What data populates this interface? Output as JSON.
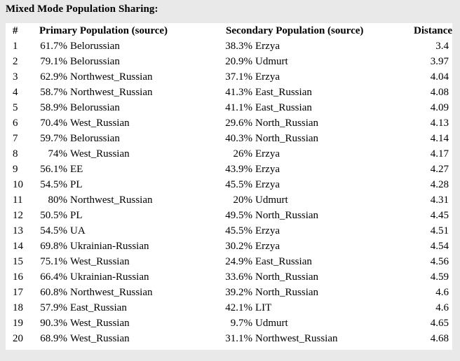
{
  "page": {
    "title": "Mixed Mode Population Sharing:",
    "background_color": "#e9e9e9",
    "panel_color": "#ffffff",
    "text_color": "#000000"
  },
  "table": {
    "headers": {
      "rank": "#",
      "primary": "Primary Population (source)",
      "secondary": "Secondary Population (source)",
      "distance": "Distance"
    },
    "rows": [
      {
        "rank": "1",
        "primary_pct": "61.7%",
        "primary_name": "Belorussian",
        "secondary_pct": "38.3%",
        "secondary_name": "Erzya",
        "distance": "3.4"
      },
      {
        "rank": "2",
        "primary_pct": "79.1%",
        "primary_name": "Belorussian",
        "secondary_pct": "20.9%",
        "secondary_name": "Udmurt",
        "distance": "3.97"
      },
      {
        "rank": "3",
        "primary_pct": "62.9%",
        "primary_name": "Northwest_Russian",
        "secondary_pct": "37.1%",
        "secondary_name": "Erzya",
        "distance": "4.04"
      },
      {
        "rank": "4",
        "primary_pct": "58.7%",
        "primary_name": "Northwest_Russian",
        "secondary_pct": "41.3%",
        "secondary_name": "East_Russian",
        "distance": "4.08"
      },
      {
        "rank": "5",
        "primary_pct": "58.9%",
        "primary_name": "Belorussian",
        "secondary_pct": "41.1%",
        "secondary_name": "East_Russian",
        "distance": "4.09"
      },
      {
        "rank": "6",
        "primary_pct": "70.4%",
        "primary_name": "West_Russian",
        "secondary_pct": "29.6%",
        "secondary_name": "North_Russian",
        "distance": "4.13"
      },
      {
        "rank": "7",
        "primary_pct": "59.7%",
        "primary_name": "Belorussian",
        "secondary_pct": "40.3%",
        "secondary_name": "North_Russian",
        "distance": "4.14"
      },
      {
        "rank": "8",
        "primary_pct": "74%",
        "primary_name": "West_Russian",
        "secondary_pct": "26%",
        "secondary_name": "Erzya",
        "distance": "4.17"
      },
      {
        "rank": "9",
        "primary_pct": "56.1%",
        "primary_name": "EE",
        "secondary_pct": "43.9%",
        "secondary_name": "Erzya",
        "distance": "4.27"
      },
      {
        "rank": "10",
        "primary_pct": "54.5%",
        "primary_name": "PL",
        "secondary_pct": "45.5%",
        "secondary_name": "Erzya",
        "distance": "4.28"
      },
      {
        "rank": "11",
        "primary_pct": "80%",
        "primary_name": "Northwest_Russian",
        "secondary_pct": "20%",
        "secondary_name": "Udmurt",
        "distance": "4.31"
      },
      {
        "rank": "12",
        "primary_pct": "50.5%",
        "primary_name": "PL",
        "secondary_pct": "49.5%",
        "secondary_name": "North_Russian",
        "distance": "4.45"
      },
      {
        "rank": "13",
        "primary_pct": "54.5%",
        "primary_name": "UA",
        "secondary_pct": "45.5%",
        "secondary_name": "Erzya",
        "distance": "4.51"
      },
      {
        "rank": "14",
        "primary_pct": "69.8%",
        "primary_name": "Ukrainian-Russian",
        "secondary_pct": "30.2%",
        "secondary_name": "Erzya",
        "distance": "4.54"
      },
      {
        "rank": "15",
        "primary_pct": "75.1%",
        "primary_name": "West_Russian",
        "secondary_pct": "24.9%",
        "secondary_name": "East_Russian",
        "distance": "4.56"
      },
      {
        "rank": "16",
        "primary_pct": "66.4%",
        "primary_name": "Ukrainian-Russian",
        "secondary_pct": "33.6%",
        "secondary_name": "North_Russian",
        "distance": "4.59"
      },
      {
        "rank": "17",
        "primary_pct": "60.8%",
        "primary_name": "Northwest_Russian",
        "secondary_pct": "39.2%",
        "secondary_name": "North_Russian",
        "distance": "4.6"
      },
      {
        "rank": "18",
        "primary_pct": "57.9%",
        "primary_name": "East_Russian",
        "secondary_pct": "42.1%",
        "secondary_name": "LIT",
        "distance": "4.6"
      },
      {
        "rank": "19",
        "primary_pct": "90.3%",
        "primary_name": "West_Russian",
        "secondary_pct": "9.7%",
        "secondary_name": "Udmurt",
        "distance": "4.65"
      },
      {
        "rank": "20",
        "primary_pct": "68.9%",
        "primary_name": "West_Russian",
        "secondary_pct": "31.1%",
        "secondary_name": "Northwest_Russian",
        "distance": "4.68"
      }
    ]
  }
}
